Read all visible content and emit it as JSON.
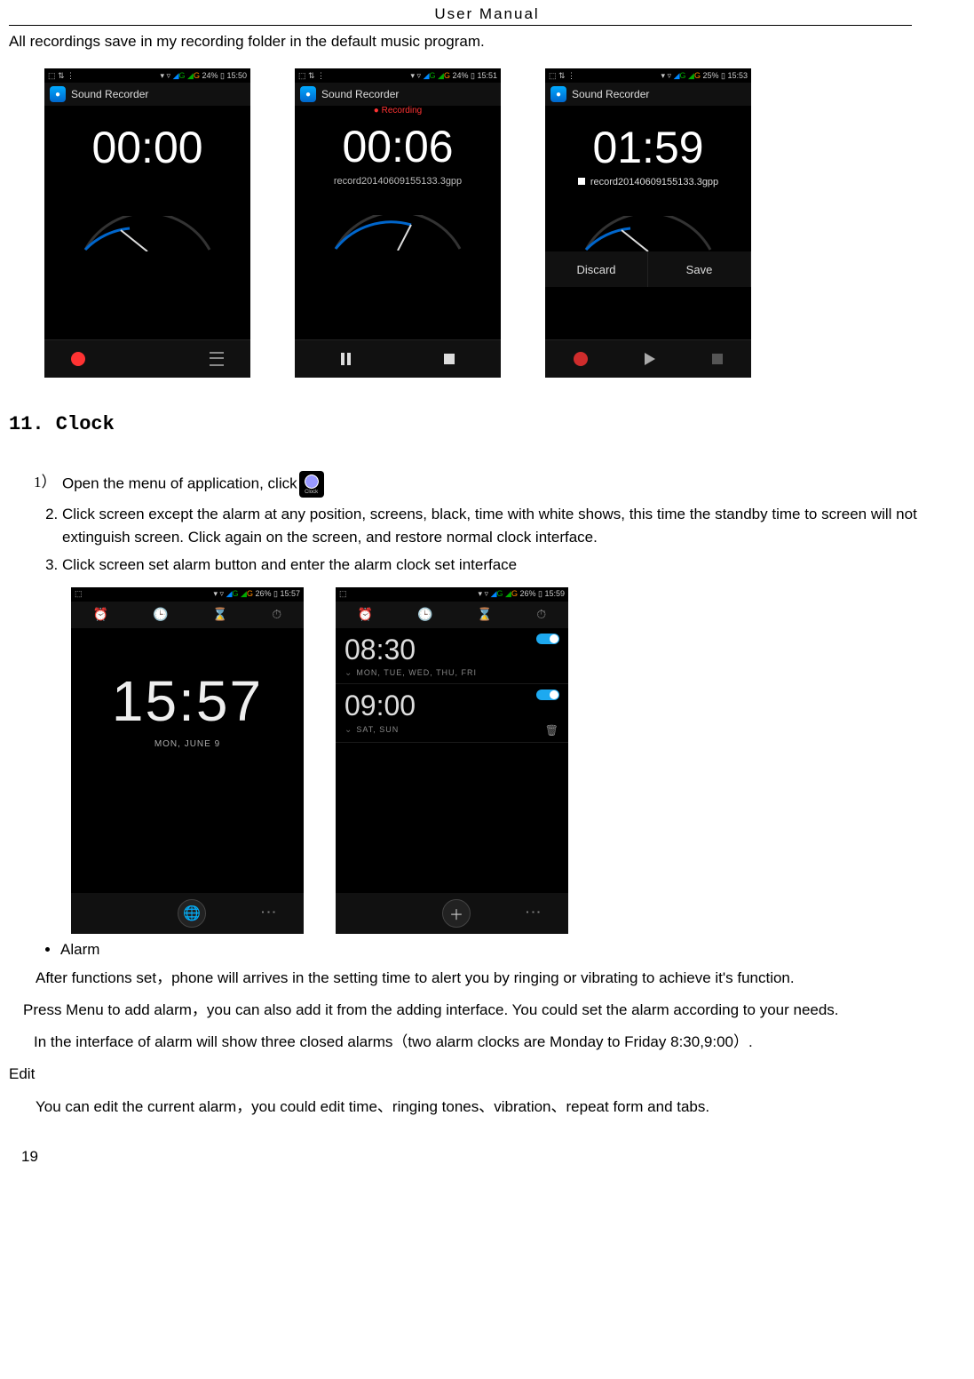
{
  "header": {
    "title": "User    Manual"
  },
  "intro": "All recordings save in my recording folder in the default music program.",
  "recorder": {
    "app_title": "Sound Recorder",
    "status_left": "⬚ ⇅ ⋮",
    "signals": "◢ G ◢ G",
    "shot1": {
      "batt": "24%",
      "time": "15:50",
      "timer": "00:00"
    },
    "shot2": {
      "batt": "24%",
      "time": "15:51",
      "timer": "00:06",
      "recording_label": "Recording",
      "file": "record20140609155133.3gpp"
    },
    "shot3": {
      "batt": "25%",
      "time": "15:53",
      "timer": "01:59",
      "file": "record20140609155133.3gpp",
      "discard": "Discard",
      "save": "Save"
    }
  },
  "section_heading": "11. Clock",
  "steps": {
    "s1": "Open the menu of application, click",
    "s2": "Click screen except the alarm at any position, screens, black, time with white shows, this time the standby time to screen will not extinguish screen. Click again on the screen, and restore normal clock interface.",
    "s3": "Click screen set alarm button and enter the alarm clock set interface"
  },
  "clockshots": {
    "shot1": {
      "batt": "26%",
      "time": "15:57",
      "big": "15:57",
      "date": "MON, JUNE 9"
    },
    "shot2": {
      "batt": "26%",
      "time": "15:59",
      "a1_time": "08:30",
      "a1_days": "MON, TUE, WED, THU, FRI",
      "a2_time": "09:00",
      "a2_days": "SAT, SUN"
    }
  },
  "bullet_alarm": "Alarm",
  "para1": "After functions set，phone will arrives in the setting time to alert you by ringing or vibrating to achieve it's function.",
  "para2": "Press Menu to add alarm，you can also add it from the adding interface. You could set the alarm according to your needs.",
  "para3": "In the interface of alarm will show three closed alarms（two alarm clocks are Monday to Friday 8:30,9:00）.",
  "edit_label": "Edit",
  "para4": "You can edit the current alarm，you could edit time、ringing tones、vibration、repeat form and tabs.",
  "page_number": "19"
}
